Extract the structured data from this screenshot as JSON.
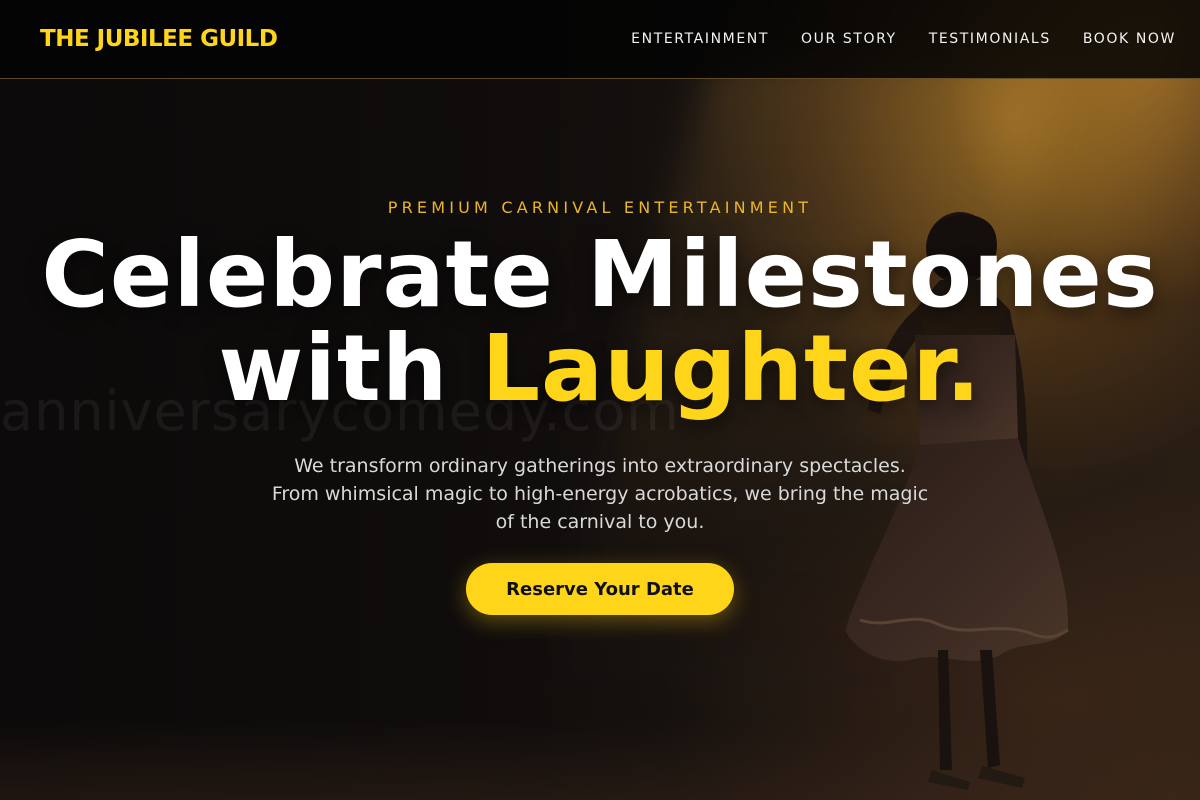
{
  "brand": {
    "name": "THE JUBILEE GUILD",
    "accent_color": "#ffd51a"
  },
  "nav": {
    "links": [
      {
        "label": "ENTERTAINMENT"
      },
      {
        "label": "OUR STORY"
      },
      {
        "label": "TESTIMONIALS"
      },
      {
        "label": "BOOK NOW"
      }
    ]
  },
  "hero": {
    "eyebrow": "PREMIUM CARNIVAL ENTERTAINMENT",
    "headline_line1": "Celebrate Milestones",
    "headline_line2_prefix": "with ",
    "headline_line2_accent": "Laughter.",
    "watermark": "anniversarycomedy.com",
    "description": "We transform ordinary gatherings into extraordinary spectacles. From whimsical magic to high-energy acrobatics, we bring the magic of the carnival to you.",
    "cta_label": "Reserve Your Date"
  },
  "background": {
    "image": "performer-silhouette-on-stage"
  }
}
